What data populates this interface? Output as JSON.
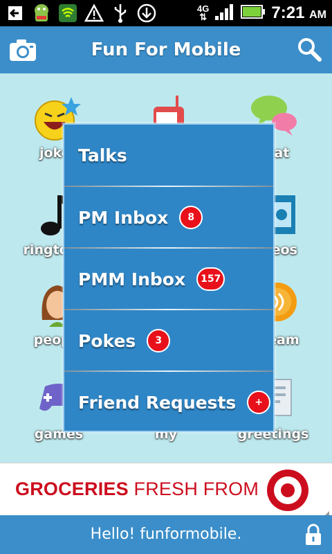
{
  "status_bar": {
    "time": "7:21",
    "ampm": "AM",
    "network": "4G"
  },
  "header": {
    "title": "Fun For Mobile"
  },
  "grid": {
    "tiles": [
      {
        "label": "jokes"
      },
      {
        "label": ""
      },
      {
        "label": "chat"
      },
      {
        "label": "ringtones"
      },
      {
        "label": ""
      },
      {
        "label": "videos"
      },
      {
        "label": "people"
      },
      {
        "label": ""
      },
      {
        "label": "stream"
      },
      {
        "label": "games"
      },
      {
        "label": "my"
      },
      {
        "label": "greetings"
      }
    ]
  },
  "menu": {
    "items": [
      {
        "label": "Talks",
        "badge": ""
      },
      {
        "label": "PM Inbox",
        "badge": "8"
      },
      {
        "label": "PMM Inbox",
        "badge": "157"
      },
      {
        "label": "Pokes",
        "badge": "3"
      },
      {
        "label": "Friend Requests",
        "badge": "+"
      }
    ]
  },
  "ad": {
    "text_bold": "GROCERIES",
    "text_rest": " FRESH FROM",
    "brand_color": "#cc0d1e"
  },
  "footer": {
    "text": "Hello! funformobile."
  },
  "colors": {
    "accent": "#3b8ec9",
    "background": "#bde9ee",
    "badge": "#e8101a"
  }
}
